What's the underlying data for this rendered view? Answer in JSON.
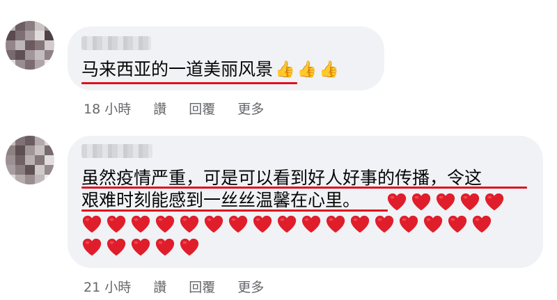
{
  "comments": [
    {
      "author": "",
      "text": "马来西亚的一道美丽风景",
      "reaction_icons": [
        "thumbs-up",
        "thumbs-up",
        "thumbs-up"
      ],
      "time": "18 小時",
      "actions": [
        "讚",
        "回覆",
        "更多"
      ]
    },
    {
      "author": "",
      "line1": "虽然疫情严重，可是可以看到好人好事的传播，令这",
      "line2": "艰难时刻能感到一丝丝温馨在心里。",
      "heart_count": 27,
      "time": "21 小時",
      "actions": [
        "讚",
        "回覆",
        "更多"
      ]
    }
  ],
  "colors": {
    "bubble": "#f0f2f5",
    "underline": "#e0101e",
    "meta_text": "#65676b",
    "heart": "#e01e2b"
  }
}
